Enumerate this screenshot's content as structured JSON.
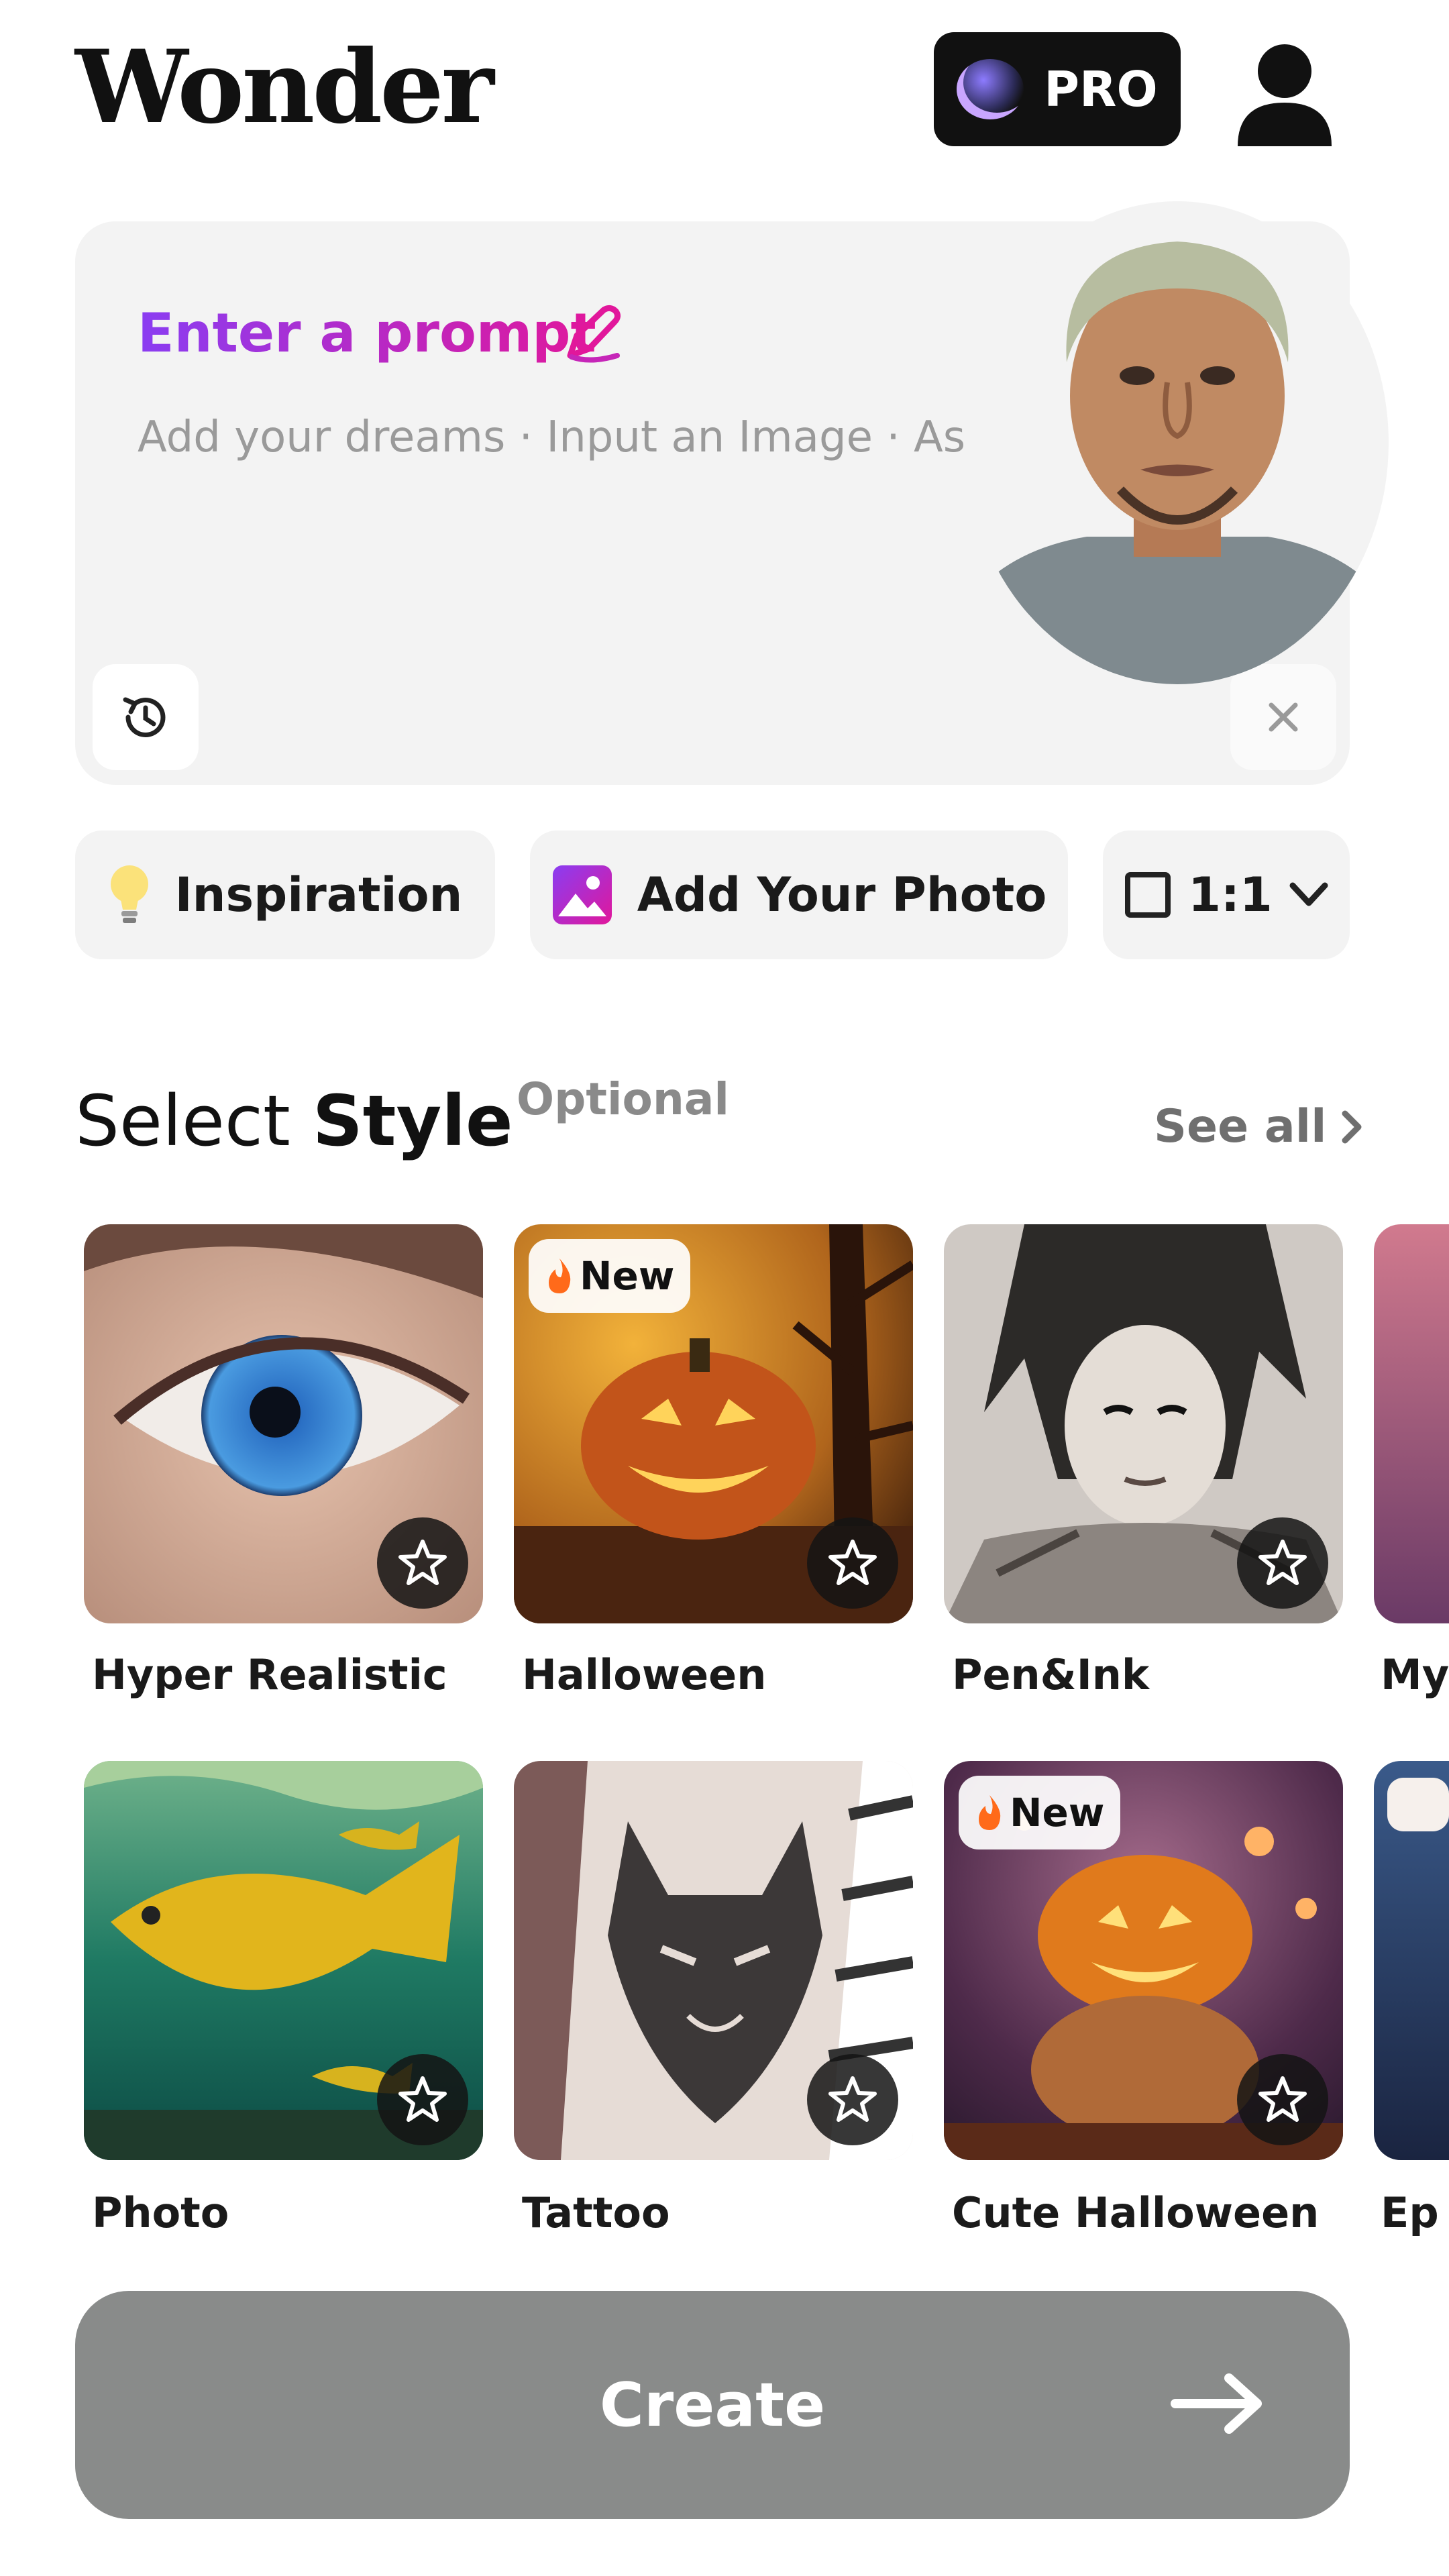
{
  "app": {
    "logo_text": "Wonder",
    "pro_label": "PRO"
  },
  "prompt": {
    "title": "Enter a prompt",
    "placeholder": "Add your dreams · Input an Image · Aspect"
  },
  "chips": {
    "inspiration": "Inspiration",
    "add_photo": "Add Your Photo",
    "aspect": "1:1"
  },
  "styles_section": {
    "title_light": "Select ",
    "title_bold": "Style",
    "optional": "Optional",
    "see_all": "See all"
  },
  "styles": [
    {
      "label": "Hyper Realistic",
      "badge": ""
    },
    {
      "label": "Halloween",
      "badge": "New"
    },
    {
      "label": "Pen&Ink",
      "badge": ""
    },
    {
      "label": "My",
      "badge": ""
    },
    {
      "label": "Photo",
      "badge": ""
    },
    {
      "label": "Tattoo",
      "badge": ""
    },
    {
      "label": "Cute Halloween",
      "badge": "New"
    },
    {
      "label": "Ep",
      "badge": ""
    }
  ],
  "create": {
    "label": "Create"
  },
  "colors": {
    "accent_gradient_start": "#8a3df2",
    "accent_gradient_end": "#e1179b",
    "create_button": "#898b8a",
    "card_background": "#f3f3f3"
  },
  "icons": [
    "user-icon",
    "pencil-icon",
    "history-icon",
    "close-icon",
    "lightbulb-icon",
    "image-icon",
    "square-icon",
    "chevron-down-icon",
    "chevron-right-icon",
    "star-icon",
    "fire-icon",
    "arrow-right-icon"
  ]
}
